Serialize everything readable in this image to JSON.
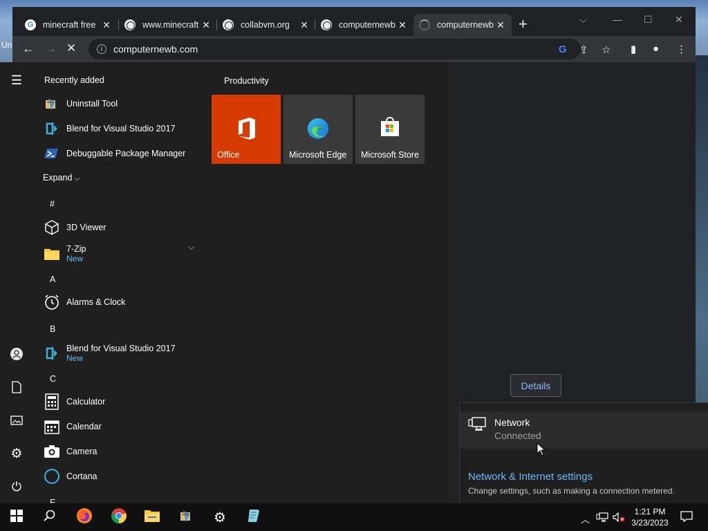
{
  "desktop": {
    "label": "Un"
  },
  "browser": {
    "tabs": [
      {
        "title": "minecraft free",
        "icon": "google-icon",
        "close": "✕"
      },
      {
        "title": "www.minecraft",
        "icon": "globe-icon",
        "close": "✕"
      },
      {
        "title": "collabvm.org",
        "icon": "globe-icon",
        "close": "✕"
      },
      {
        "title": "computernewb",
        "icon": "globe-icon",
        "close": "✕"
      },
      {
        "title": "computernewb",
        "icon": "spinner-icon",
        "close": "✕"
      }
    ],
    "url": "computernewb.com",
    "details_label": "Details"
  },
  "start_menu": {
    "recently_added_title": "Recently added",
    "recent": [
      {
        "name": "Uninstall Tool",
        "icon": "uninstall-tool-icon"
      },
      {
        "name": "Blend for Visual Studio 2017",
        "icon": "blend-icon"
      },
      {
        "name": "Debuggable Package Manager",
        "icon": "powershell-icon"
      }
    ],
    "expand_label": "Expand",
    "letters": {
      "hash": "#",
      "a": "A",
      "b": "B",
      "c": "C",
      "e": "E"
    },
    "apps": [
      {
        "name": "3D Viewer",
        "icon": "cube-icon"
      },
      {
        "name": "7-Zip",
        "sub": "New",
        "icon": "folder-icon"
      },
      {
        "name": "Alarms & Clock",
        "icon": "clock-icon"
      },
      {
        "name": "Blend for Visual Studio 2017",
        "sub": "New",
        "icon": "blend-icon"
      },
      {
        "name": "Calculator",
        "icon": "calculator-icon"
      },
      {
        "name": "Calendar",
        "icon": "calendar-icon"
      },
      {
        "name": "Camera",
        "icon": "camera-icon"
      },
      {
        "name": "Cortana",
        "icon": "cortana-icon"
      }
    ],
    "productivity_title": "Productivity",
    "tiles": [
      {
        "label": "Office",
        "color": "#d83b01",
        "icon": "office-icon"
      },
      {
        "label": "Microsoft Edge",
        "color": "#3a3a3a",
        "icon": "edge-icon"
      },
      {
        "label": "Microsoft Store",
        "color": "#3a3a3a",
        "icon": "store-icon"
      }
    ]
  },
  "network_flyout": {
    "network_name": "Network",
    "network_status": "Connected",
    "settings_link": "Network & Internet settings",
    "settings_desc": "Change settings, such as making a connection metered."
  },
  "taskbar": {
    "time": "1:21 PM",
    "date": "3/23/2023"
  },
  "colors": {
    "accent_blue": "#6cb8f6",
    "office_orange": "#d83b01",
    "chrome_dark": "#202124"
  }
}
